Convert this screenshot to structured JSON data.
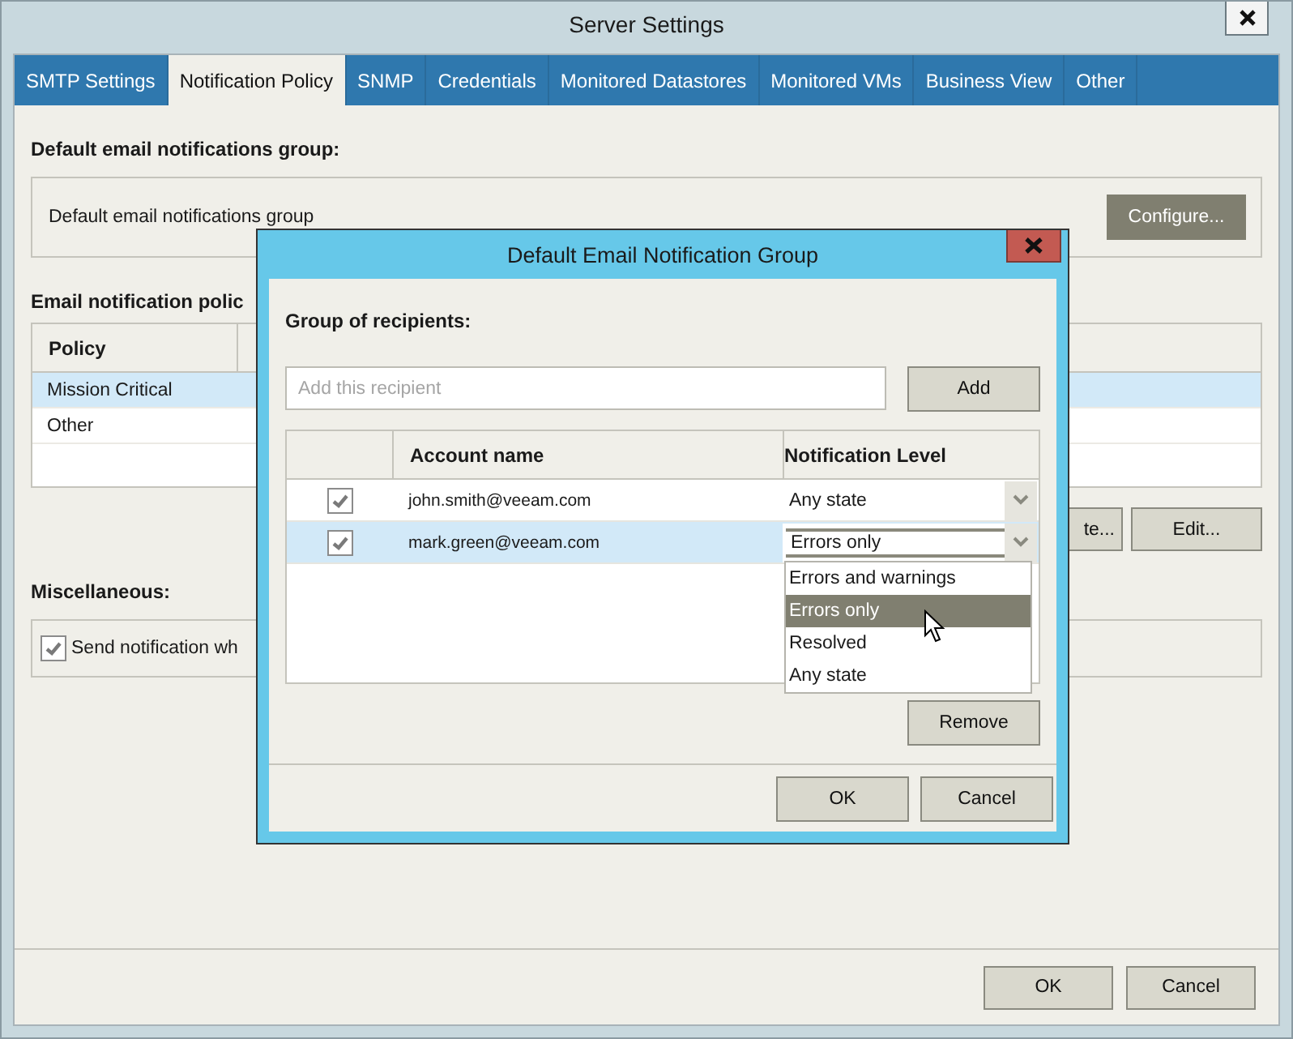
{
  "window": {
    "title": "Server Settings"
  },
  "tabs": [
    {
      "label": "SMTP Settings",
      "selected": false
    },
    {
      "label": "Notification Policy",
      "selected": true
    },
    {
      "label": "SNMP",
      "selected": false
    },
    {
      "label": "Credentials",
      "selected": false
    },
    {
      "label": "Monitored Datastores",
      "selected": false
    },
    {
      "label": "Monitored VMs",
      "selected": false
    },
    {
      "label": "Business View",
      "selected": false
    },
    {
      "label": "Other",
      "selected": false
    }
  ],
  "default_group": {
    "heading": "Default email notifications group:",
    "label": "Default email notifications group",
    "button": {
      "label": "Configure...",
      "highlighted": true
    }
  },
  "policies": {
    "heading": "Email notification polic",
    "columns": [
      "Policy"
    ],
    "rows": [
      {
        "policy": "Mission Critical",
        "selected": true
      },
      {
        "policy": "Other",
        "selected": false
      }
    ],
    "buttons": [
      "te...",
      "Edit..."
    ]
  },
  "miscellaneous": {
    "heading": "Miscellaneous:",
    "options": [
      {
        "label": "Send notification wh",
        "checked": true
      }
    ]
  },
  "buttons": [
    "OK",
    "Cancel"
  ],
  "dialog": {
    "title": "Default Email Notification Group",
    "recipients_label": "Group of recipients:",
    "recipient_field": {
      "placeholder": "Add this recipient"
    },
    "add_button": "Add",
    "columns": [
      "Account name",
      "Notification Level"
    ],
    "rows": [
      {
        "checked": true,
        "account": "john.smith@veeam.com",
        "level": "Any state",
        "selected": false,
        "open": false
      },
      {
        "checked": true,
        "account": "mark.green@veeam.com",
        "level": "Errors only",
        "selected": true,
        "open": true
      }
    ],
    "dropdown": [
      {
        "label": "Errors and warnings",
        "selected": false
      },
      {
        "label": "Errors only",
        "selected": true
      },
      {
        "label": "Resolved",
        "selected": false
      },
      {
        "label": "Any state",
        "selected": false
      }
    ],
    "remove_button": "Remove",
    "buttons": [
      "OK",
      "Cancel"
    ]
  }
}
